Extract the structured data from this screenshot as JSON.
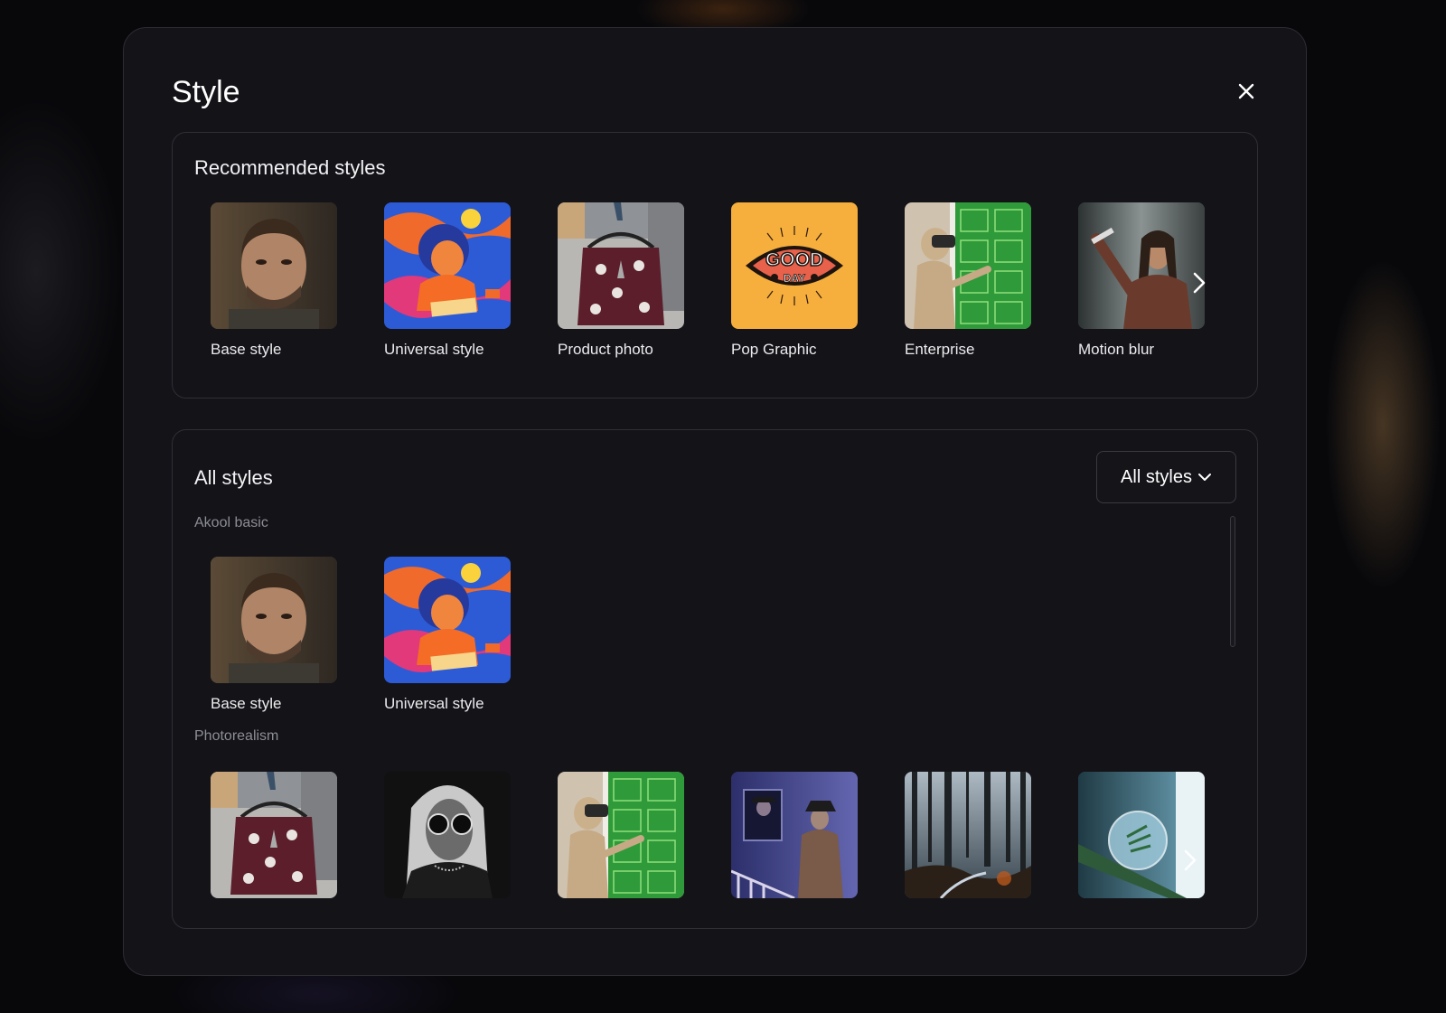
{
  "modal": {
    "title": "Style",
    "close_icon": "close-icon"
  },
  "recommended": {
    "title": "Recommended styles",
    "items": [
      {
        "label": "Base style",
        "icon": "portrait-man-thumbnail"
      },
      {
        "label": "Universal style",
        "icon": "illustration-child-drawing-thumbnail"
      },
      {
        "label": "Product photo",
        "icon": "tote-bag-photo-thumbnail"
      },
      {
        "label": "Pop Graphic",
        "icon": "good-day-graphic-thumbnail"
      },
      {
        "label": "Enterprise",
        "icon": "robot-vr-thumbnail"
      },
      {
        "label": "Motion blur",
        "icon": "singer-motion-blur-thumbnail"
      }
    ],
    "next_icon": "chevron-right-icon"
  },
  "all_styles": {
    "title": "All styles",
    "filter": {
      "selected": "All styles",
      "icon": "chevron-down-icon"
    },
    "groups": [
      {
        "label": "Akool basic",
        "items": [
          {
            "label": "Base style",
            "icon": "portrait-man-thumbnail"
          },
          {
            "label": "Universal style",
            "icon": "illustration-child-drawing-thumbnail"
          }
        ]
      },
      {
        "label": "Photorealism",
        "items": [
          {
            "icon": "tote-bag-photo-thumbnail"
          },
          {
            "icon": "woman-sunglasses-bw-thumbnail"
          },
          {
            "icon": "robot-vr-thumbnail"
          },
          {
            "icon": "detective-mirror-thumbnail"
          },
          {
            "icon": "misty-forest-thumbnail"
          },
          {
            "icon": "water-droplet-macro-thumbnail"
          }
        ]
      }
    ],
    "next_icon": "chevron-right-icon"
  },
  "colors": {
    "modal_bg": "#131318",
    "border": "#2f2f37",
    "pop_graphic_bg": "#f6ae3c",
    "muted_text": "#8d8d96"
  }
}
